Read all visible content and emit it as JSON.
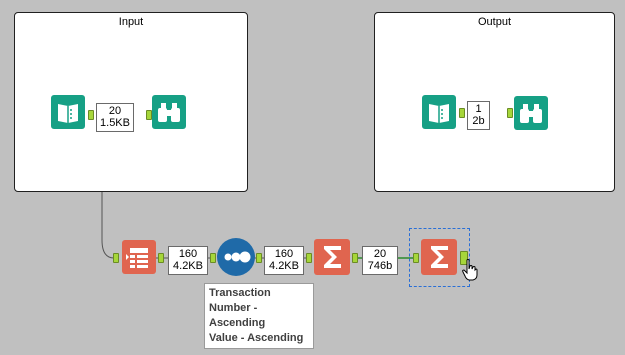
{
  "containers": {
    "input": {
      "title": "Input"
    },
    "output": {
      "title": "Output"
    }
  },
  "tools": {
    "input_data": {
      "icon": "book-input-icon",
      "color": "#16a085"
    },
    "input_browse": {
      "icon": "binoculars-icon",
      "color": "#16a085"
    },
    "output_data": {
      "icon": "book-input-icon",
      "color": "#16a085"
    },
    "output_browse": {
      "icon": "binoculars-icon",
      "color": "#16a085"
    },
    "select": {
      "icon": "table-select-icon",
      "color": "#e0654f"
    },
    "sort": {
      "icon": "three-dots-icon",
      "color": "#1f6aa8"
    },
    "summarize_1": {
      "icon": "sigma-icon",
      "color": "#e0654f"
    },
    "summarize_2": {
      "icon": "sigma-icon",
      "color": "#e0654f"
    }
  },
  "badges": {
    "input_out": {
      "records": "20",
      "size": "1.5KB"
    },
    "output_out": {
      "records": "1",
      "size": "2b"
    },
    "select_out": {
      "records": "160",
      "size": "4.2KB"
    },
    "sort_out": {
      "records": "160",
      "size": "4.2KB"
    },
    "summarize_out": {
      "records": "20",
      "size": "746b"
    }
  },
  "annotation": {
    "line1": "Transaction",
    "line2": "Number -",
    "line3": "Ascending",
    "line4": "Value - Ascending"
  },
  "colors": {
    "canvas": "#c0c0c0",
    "anchor": "#a6d63a",
    "selection": "#2a6fd6",
    "wire": "#555555"
  }
}
